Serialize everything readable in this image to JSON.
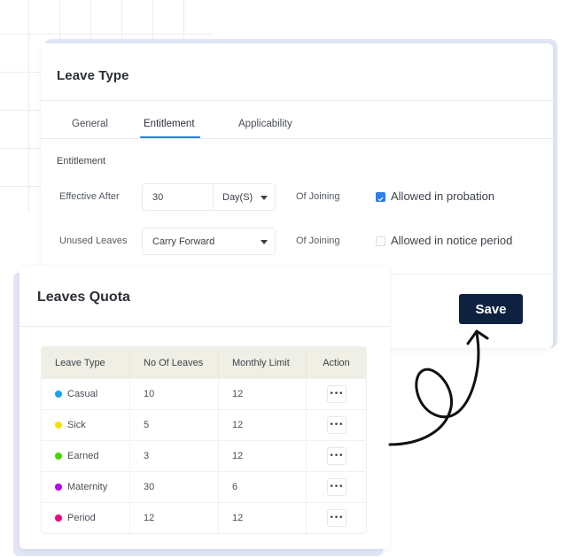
{
  "leave_type_card": {
    "title": "Leave Type",
    "tabs": [
      {
        "label": "General",
        "active": false
      },
      {
        "label": "Entitlement",
        "active": true
      },
      {
        "label": "Applicability",
        "active": false
      }
    ],
    "section_label": "Entitlement",
    "effective_after": {
      "label": "Effective After",
      "value": "30",
      "unit": "Day(S)",
      "suffix": "Of Joining",
      "checkbox": {
        "label": "Allowed in probation",
        "checked": true
      }
    },
    "unused_leaves": {
      "label": "Unused Leaves",
      "value": "Carry Forward",
      "suffix": "Of Joining",
      "checkbox": {
        "label": "Allowed in notice period",
        "checked": false
      }
    },
    "save_label": "Save"
  },
  "leaves_quota_card": {
    "title": "Leaves Quota",
    "columns": [
      "Leave Type",
      "No Of Leaves",
      "Monthly Limit",
      "Action"
    ],
    "rows": [
      {
        "type": "Casual",
        "color": "#1aa3e8",
        "leaves": "10",
        "monthly_limit": "12",
        "action_icon": "more-horizontal-icon"
      },
      {
        "type": "Sick",
        "color": "#f5e100",
        "leaves": "5",
        "monthly_limit": "12",
        "action_icon": "more-horizontal-icon"
      },
      {
        "type": "Earned",
        "color": "#46d400",
        "leaves": "3",
        "monthly_limit": "12",
        "action_icon": "more-horizontal-icon"
      },
      {
        "type": "Maternity",
        "color": "#b800f0",
        "leaves": "30",
        "monthly_limit": "6",
        "action_icon": "more-horizontal-icon"
      },
      {
        "type": "Period",
        "color": "#f0007e",
        "leaves": "12",
        "monthly_limit": "12",
        "action_icon": "more-horizontal-icon"
      }
    ],
    "more_glyph": "•••"
  },
  "colors": {
    "accent": "#2b7de9",
    "save_button": "#0f2140",
    "card_shadow": "#e1e6f5",
    "table_header": "#f0efe5"
  }
}
